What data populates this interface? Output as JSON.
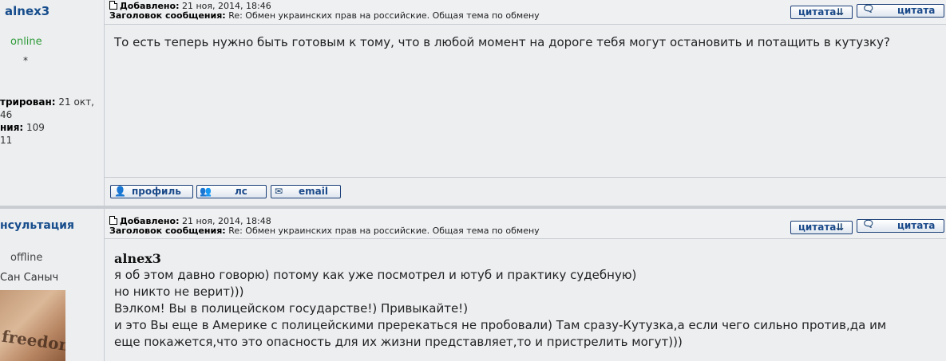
{
  "posts": [
    {
      "author": "alnex3",
      "status": "online",
      "star": "*",
      "registered_label": "трирован:",
      "registered_value": "21 окт,",
      "registered_cont": "46",
      "messages_label": "ния:",
      "messages_value": "109",
      "extra": "11",
      "added_label": "Добавлено:",
      "added_value": "21 ноя, 2014, 18:46",
      "subject_label": "Заголовок сообщения:",
      "subject_value": "Re: Обмен украинских прав на российские. Общая тема по обмену",
      "lines": [
        "То есть теперь нужно быть готовым к тому, что в любой момент на дороге тебя могут остановить и потащить в кутузку?"
      ],
      "footer_buttons": {
        "profile": "профиль",
        "pm": "лс",
        "email": "email"
      }
    },
    {
      "author": "нсультация",
      "status": "offline",
      "rank": "Сан Саныч",
      "added_label": "Добавлено:",
      "added_value": "21 ноя, 2014, 18:48",
      "subject_label": "Заголовок сообщения:",
      "subject_value": "Re: Обмен украинских прав на российские. Общая тема по обмену",
      "quote_author": "alnex3",
      "lines": [
        "я об этом давно говорю) потому как уже посмотрел и ютуб и практику судебную)",
        "но никто не верит)))",
        "Вэлком! Вы в полицейском государстве!) Привыкайте!)",
        "и это Вы еще в Америке с полицейскими пререкаться не пробовали) Там сразу-Кутузка,а если чего сильно против,да им",
        "еще покажется,что это опасность для их жизни представляет,то и пристрелить могут)))"
      ],
      "avatar_text": "freedom"
    }
  ],
  "buttons": {
    "quote_multi": "цитата",
    "quote": "цитата"
  }
}
